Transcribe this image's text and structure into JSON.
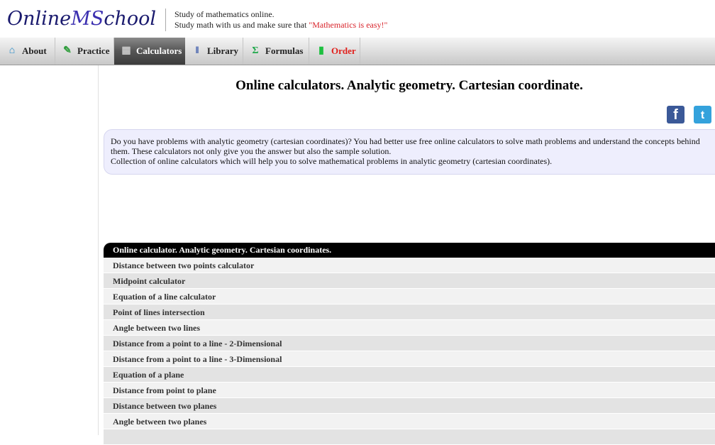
{
  "header": {
    "logo_part1": "Online",
    "logo_part2": "MS",
    "logo_part3": "chool",
    "tagline_line1": "Study of mathematics online.",
    "tagline_line2_prefix": "Study math with us and make sure that ",
    "tagline_line2_highlight": "\"Mathematics is easy!\""
  },
  "nav": {
    "items": [
      {
        "label": "About",
        "icon": "house-icon"
      },
      {
        "label": "Practice",
        "icon": "pencil-icon"
      },
      {
        "label": "Calculators",
        "icon": "calculator-icon",
        "active": true
      },
      {
        "label": "Library",
        "icon": "books-icon"
      },
      {
        "label": "Formulas",
        "icon": "sigma-icon"
      },
      {
        "label": "Order",
        "icon": "cart-icon"
      }
    ]
  },
  "main": {
    "title": "Online calculators. Analytic geometry. Cartesian coordinate.",
    "intro_p1": "Do you have problems with analytic geometry (cartesian coordinates)? You had better use free online calculators to solve math problems and understand the concepts behind them. These calculators not only give you the answer but also the sample solution.",
    "intro_p2": "Collection of online calculators which will help you to solve mathematical problems in analytic geometry (cartesian coordinates).",
    "social": {
      "facebook": "f",
      "twitter": "t"
    }
  },
  "table": {
    "header": "Online calculator. Analytic geometry. Cartesian coordinates.",
    "rows": [
      "Distance between two points calculator",
      "Midpoint calculator",
      "Equation of a line calculator",
      "Point of lines intersection",
      "Angle between two lines",
      "Distance from a point to a line - 2-Dimensional",
      "Distance from a point to a line - 3-Dimensional",
      "Equation of a plane",
      "Distance from point to plane",
      "Distance between two planes",
      "Angle between two planes",
      ""
    ]
  },
  "colors": {
    "accent_red": "#d8232a",
    "logo_blue": "#1a1a6e",
    "intro_bg": "#eeeefd",
    "facebook": "#3b5998",
    "twitter": "#34a2dc"
  }
}
